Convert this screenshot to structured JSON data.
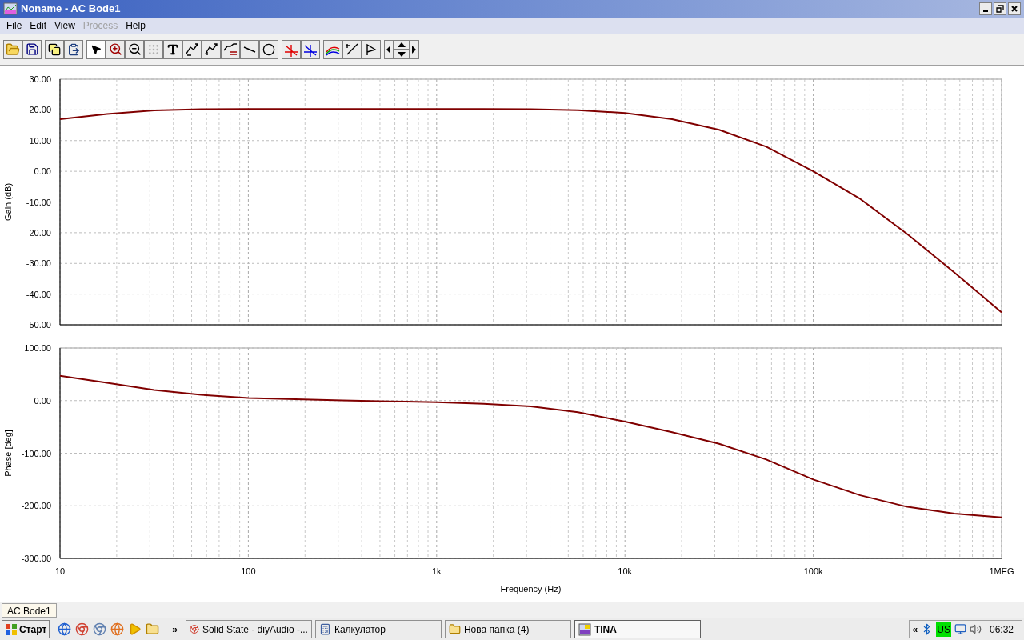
{
  "window": {
    "title": "Noname - AC Bode1"
  },
  "menu": [
    {
      "label": "File",
      "disabled": false
    },
    {
      "label": "Edit",
      "disabled": false
    },
    {
      "label": "View",
      "disabled": false
    },
    {
      "label": "Process",
      "disabled": true
    },
    {
      "label": "Help",
      "disabled": false
    }
  ],
  "gain_plot": {
    "chart_data": {
      "type": "line",
      "ylabel": "Gain (dB)",
      "grid": true,
      "ylim": [
        -50,
        30
      ],
      "yticks": [
        {
          "value": 30,
          "label": "30.00"
        },
        {
          "value": 20,
          "label": "20.00"
        },
        {
          "value": 10,
          "label": "10.00"
        },
        {
          "value": 0,
          "label": "0.00"
        },
        {
          "value": -10,
          "label": "-10.00"
        },
        {
          "value": -20,
          "label": "-20.00"
        },
        {
          "value": -30,
          "label": "-30.00"
        },
        {
          "value": -40,
          "label": "-40.00"
        },
        {
          "value": -50,
          "label": "-50.00"
        }
      ],
      "series": [
        {
          "color": "#800000",
          "values": [
            17,
            18.7,
            19.8,
            20.2,
            20.3,
            20.3,
            20.3,
            20.3,
            20.3,
            20.3,
            20.2,
            19.9,
            19,
            17,
            13.5,
            8,
            0,
            -9,
            -20.5,
            -33,
            -46
          ]
        }
      ]
    }
  },
  "phase_plot": {
    "chart_data": {
      "type": "line",
      "xlabel": "Frequency (Hz)",
      "ylabel": "Phase [deg]",
      "grid": true,
      "ylim": [
        -300,
        100
      ],
      "categories": [
        "10",
        null,
        null,
        null,
        "100",
        null,
        null,
        null,
        "1k",
        null,
        null,
        null,
        "10k",
        null,
        null,
        null,
        "100k",
        null,
        null,
        null,
        "1MEG"
      ],
      "yticks": [
        {
          "value": 100,
          "label": "100.00"
        },
        {
          "value": 0,
          "label": "0.00"
        },
        {
          "value": -100,
          "label": "-100.00"
        },
        {
          "value": -200,
          "label": "-200.00"
        },
        {
          "value": -300,
          "label": "-300.00"
        }
      ],
      "series": [
        {
          "color": "#800000",
          "values": [
            47,
            34,
            20,
            11,
            5,
            2.5,
            0.5,
            -1.5,
            -3,
            -6,
            -11,
            -22,
            -40,
            -60,
            -82,
            -112,
            -150,
            -180,
            -202,
            -215,
            -222
          ]
        }
      ]
    }
  },
  "doc_tabs": [
    {
      "label": "AC Bode1",
      "selected": true
    }
  ],
  "taskbar": {
    "start": "Старт",
    "more": "»",
    "tasks": [
      {
        "label": "Solid State - diyAudio -...",
        "kind": "browser",
        "selected": false
      },
      {
        "label": "Калкулатор",
        "kind": "calculator",
        "selected": false
      },
      {
        "label": "Нова папка (4)",
        "kind": "folder",
        "selected": false
      },
      {
        "label": "TINA",
        "kind": "tina",
        "selected": true
      }
    ],
    "tray": {
      "expand": "«",
      "language": "US",
      "time": "06:32"
    }
  }
}
